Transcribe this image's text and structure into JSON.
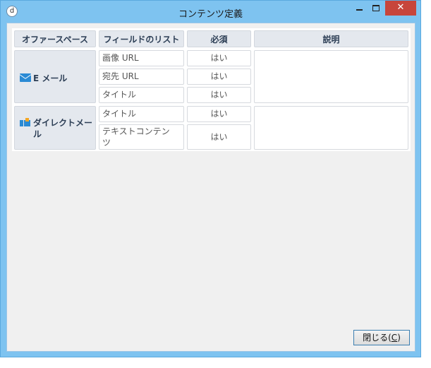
{
  "window": {
    "title": "コンテンツ定義",
    "icon": "app-icon",
    "icon_glyph": "d",
    "close_glyph": "✕"
  },
  "table": {
    "headers": {
      "offer_space": "オファースペース",
      "field_list": "フィールドのリスト",
      "required": "必須",
      "description": "説明"
    },
    "groups": [
      {
        "name": "E メール",
        "icon": "mail-icon",
        "fields": [
          {
            "name": "画像 URL",
            "required": "はい"
          },
          {
            "name": "宛先 URL",
            "required": "はい"
          },
          {
            "name": "タイトル",
            "required": "はい"
          }
        ],
        "description": ""
      },
      {
        "name": "ダイレクトメール",
        "icon": "direct-mail-icon",
        "fields": [
          {
            "name": "タイトル",
            "required": "はい"
          },
          {
            "name": "テキストコンテンツ",
            "required": "はい"
          }
        ],
        "description": ""
      }
    ]
  },
  "footer": {
    "close_label": "閉じる(",
    "close_accel": "C",
    "close_suffix": ")"
  },
  "colors": {
    "titlebar": "#7ec3f0",
    "close_button": "#c7453b",
    "header_bg": "#e4e8ee",
    "accent_blue": "#2a8ad4"
  }
}
